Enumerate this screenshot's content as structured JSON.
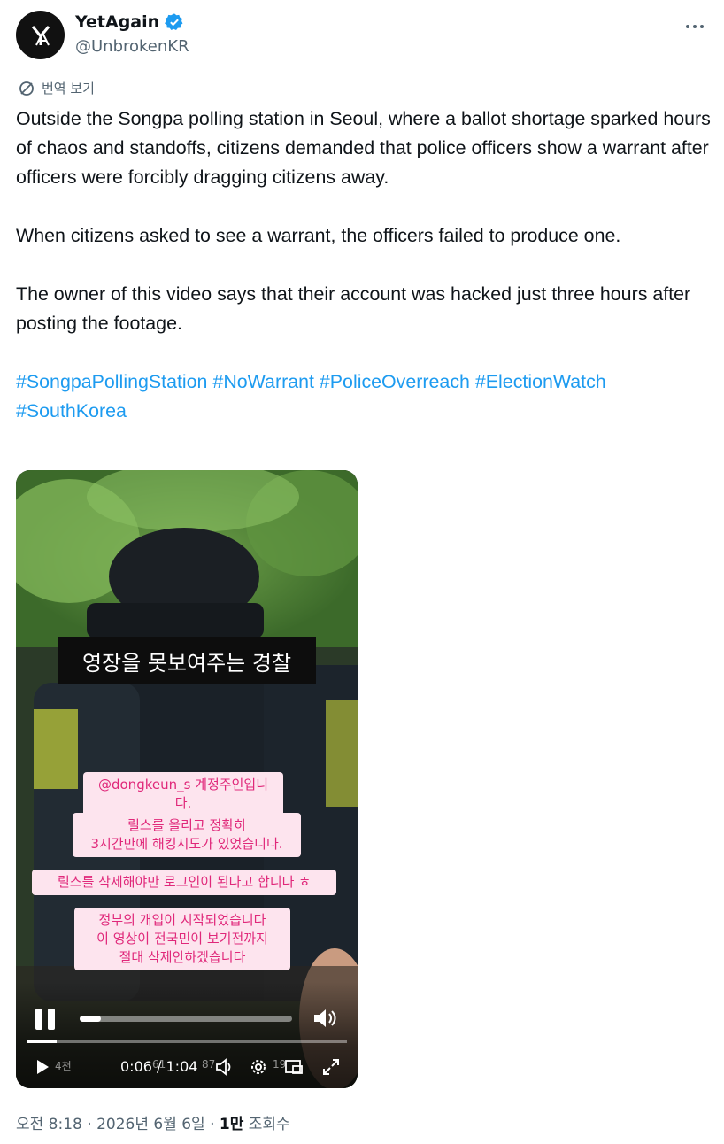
{
  "author": {
    "display_name": "YetAgain",
    "handle": "@UnbrokenKR",
    "verified": true,
    "avatar_icon": "ya-logo-icon"
  },
  "translate_label": "번역 보기",
  "tweet": {
    "paragraph1": "Outside the Songpa polling station in Seoul, where a ballot shortage sparked hours of chaos and standoffs, citizens demanded that police officers show a warrant after officers were forcibly dragging citizens away.",
    "paragraph2": "When citizens asked to see a warrant, the officers failed to produce one.",
    "paragraph3": "The owner of this video says that their account was hacked just three hours after posting the footage.",
    "hashtags": [
      "#SongpaPollingStation",
      "#NoWarrant",
      "#PoliceOverreach",
      "#ElectionWatch",
      "#SouthKorea"
    ]
  },
  "video": {
    "caption_main": "영장을 못보여주는 경찰",
    "overlay1": "@dongkeun_s 계정주인입니다.",
    "overlay2_line1": "릴스를 올리고 정확히",
    "overlay2_line2": "3시간만에 해킹시도가 있었습니다.",
    "overlay3": "릴스를 삭제해야만 로그인이 된다고 합니다 ㅎ",
    "overlay4_line1": "정부의 개입이 시작되었습니다",
    "overlay4_line2": "이 영상이 전국민이 보기전까지",
    "overlay4_line3": "절대 삭제안하겠습니다",
    "time_display": "0:06 / 1:04",
    "progress_fraction": 0.094,
    "ghost_likes": "4천",
    "ghost_comments": "61",
    "ghost_shares": "87",
    "ghost_saves": "19"
  },
  "meta": {
    "timestamp": "오전 8:18 · 2026년 6월 6일 · ",
    "views_count": "1만",
    "views_label": " 조회수"
  },
  "colors": {
    "link": "#1d9bf0",
    "secondary_text": "#536471",
    "overlay_pink_bg": "#fde4ee",
    "overlay_pink_text": "#e0287a"
  }
}
